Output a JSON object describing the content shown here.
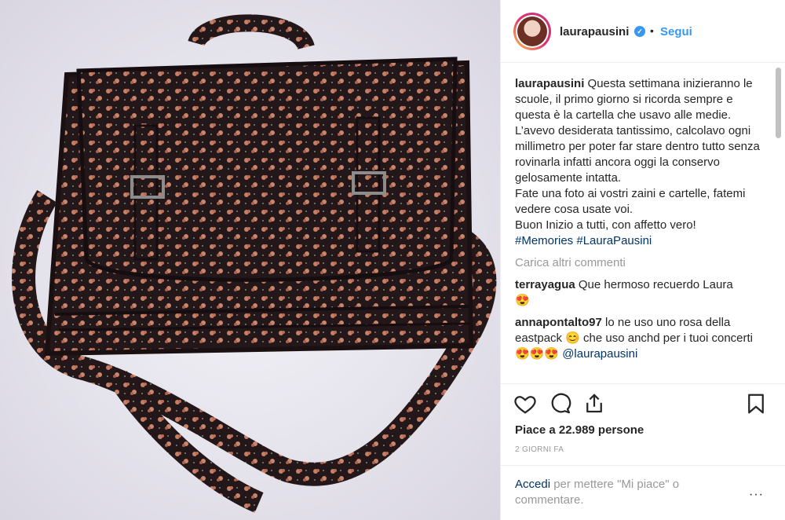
{
  "post": {
    "username": "laurapausini",
    "verified_icon": "verified-badge-icon",
    "separator": "•",
    "follow_label": "Segui"
  },
  "caption": {
    "username": "laurapausini",
    "text": "Questa settimana inizieranno le scuole, il primo giorno si ricorda sempre e questa è la cartella che usavo alle medie. L’avevo desiderata tantissimo, calcolavo ogni millimetro per poter far stare dentro tutto senza rovinarla infatti ancora oggi la conservo gelosamente intatta.\nFate una foto ai vostri zaini e cartelle, fatemi vedere cosa usate voi.\nBuon Inizio a tutti, con affetto vero!",
    "hashtags": "#Memories #LauraPausini"
  },
  "load_more": "Carica altri commenti",
  "comments": [
    {
      "username": "terrayagua",
      "text": "Que hermoso recuerdo Laura",
      "emoji": "😍"
    },
    {
      "username": "annapontalto97",
      "text": "lo ne uso uno rosa della eastpack 😊 che uso anchd per i tuoi concerti 😍😍😍",
      "mention": "@laurapausini"
    }
  ],
  "actions": {
    "like_icon": "heart-icon",
    "comment_icon": "comment-icon",
    "share_icon": "share-icon",
    "save_icon": "bookmark-icon"
  },
  "likes": "Piace a 22.989 persone",
  "time": "2 GIORNI FA",
  "login": {
    "link": "Accedi",
    "text": " per mettere \"Mi piace\" o commentare.",
    "more": "···"
  },
  "colors": {
    "link": "#3897f0",
    "hashtag": "#003569",
    "muted": "#999999",
    "bag": "#2a1a17",
    "flower": "#c77f66"
  }
}
